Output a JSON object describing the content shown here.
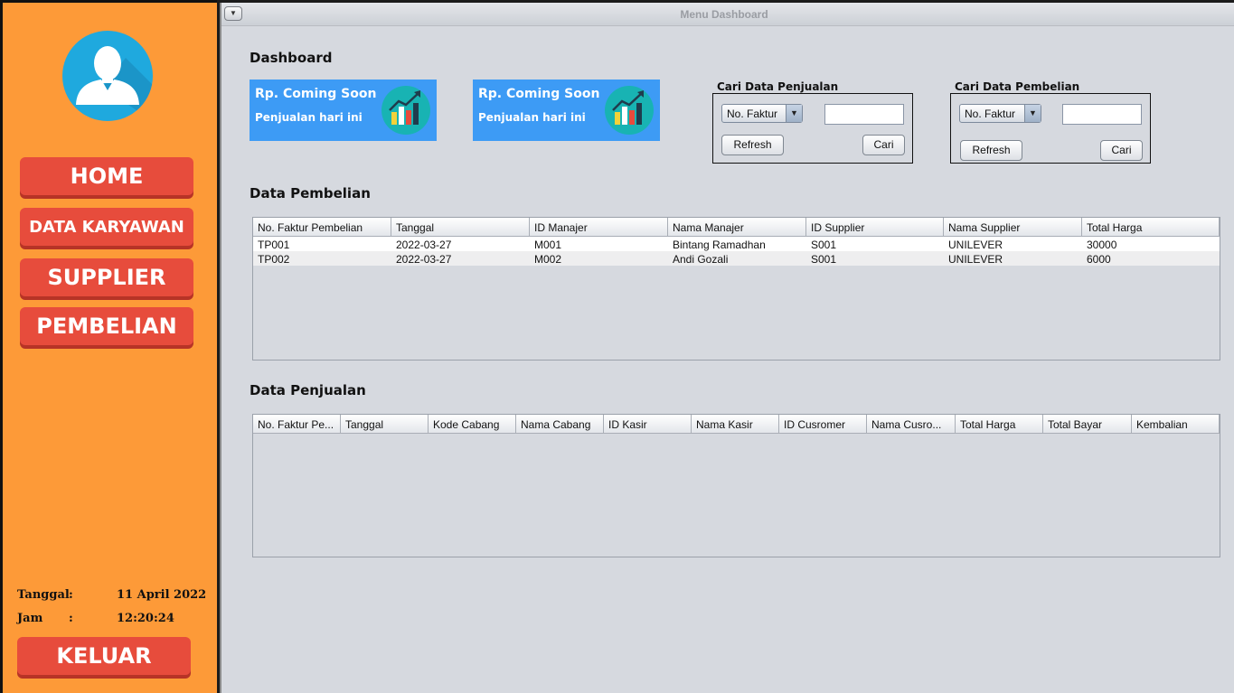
{
  "sidebar": {
    "nav": [
      "HOME",
      "DATA KARYAWAN",
      "SUPPLIER",
      "PEMBELIAN"
    ],
    "tanggal_label": "Tanggal",
    "tanggal_value": "11 April 2022",
    "jam_label": "Jam",
    "jam_value": "12:20:24",
    "colon": ":",
    "keluar": "KELUAR"
  },
  "window": {
    "title": "Menu Dashboard"
  },
  "dashboard": {
    "title": "Dashboard",
    "cards": [
      {
        "rp": "Rp.  Coming Soon",
        "sub": "Penjualan hari ini"
      },
      {
        "rp": "Rp.  Coming Soon",
        "sub": "Penjualan hari ini"
      }
    ]
  },
  "search_penjualan": {
    "label": "Cari Data Penjualan",
    "combo": "No. Faktur",
    "refresh": "Refresh",
    "cari": "Cari"
  },
  "search_pembelian": {
    "label": "Cari Data Pembelian",
    "combo": "No. Faktur",
    "refresh": "Refresh",
    "cari": "Cari"
  },
  "pembelian": {
    "title": "Data Pembelian",
    "columns": [
      "No. Faktur Pembelian",
      "Tanggal",
      "ID Manajer",
      "Nama Manajer",
      "ID Supplier",
      "Nama Supplier",
      "Total Harga"
    ],
    "rows": [
      [
        "TP001",
        "2022-03-27",
        "M001",
        "Bintang Ramadhan",
        "S001",
        "UNILEVER",
        "30000"
      ],
      [
        "TP002",
        "2022-03-27",
        "M002",
        "Andi Gozali",
        "S001",
        "UNILEVER",
        "6000"
      ]
    ]
  },
  "penjualan": {
    "title": "Data Penjualan",
    "columns": [
      "No. Faktur Pe...",
      "Tanggal",
      "Kode Cabang",
      "Nama Cabang",
      "ID Kasir",
      "Nama Kasir",
      "ID Cusromer",
      "Nama Cusro...",
      "Total Harga",
      "Total Bayar",
      "Kembalian"
    ],
    "rows": []
  },
  "colors": {
    "sidebar": "#fd9a38",
    "nav_button": "#e74c3c",
    "card": "#3d9bf5",
    "avatar": "#1fa9de",
    "panel": "#d6d9df"
  },
  "icons": [
    "user-avatar-icon",
    "bar-chart-up-icon",
    "chevron-down-icon"
  ]
}
